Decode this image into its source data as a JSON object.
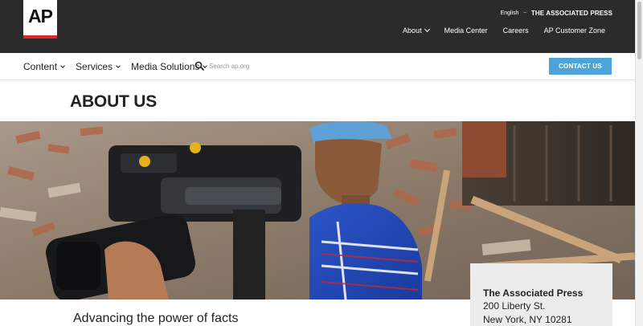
{
  "logo": {
    "text": "AP"
  },
  "utility": {
    "language": "English",
    "brand": "THE ASSOCIATED PRESS"
  },
  "top_nav": [
    {
      "label": "About",
      "has_dropdown": true
    },
    {
      "label": "Media Center",
      "has_dropdown": false
    },
    {
      "label": "Careers",
      "has_dropdown": false
    },
    {
      "label": "AP Customer Zone",
      "has_dropdown": false
    }
  ],
  "main_nav": [
    {
      "label": "Content"
    },
    {
      "label": "Services"
    },
    {
      "label": "Media Solutions"
    }
  ],
  "search": {
    "placeholder": "Search ap.org",
    "icon": "search-icon"
  },
  "contact_button": {
    "label": "CONTACT US"
  },
  "page_title": "ABOUT US",
  "tagline": "Advancing the power of facts",
  "address": {
    "name": "The Associated Press",
    "street": "200 Liberty St.",
    "city": "New York, NY 10281"
  },
  "colors": {
    "topbar": "#2b2b2b",
    "accent_blue": "#4ea3d8",
    "logo_red": "#e0262b"
  }
}
